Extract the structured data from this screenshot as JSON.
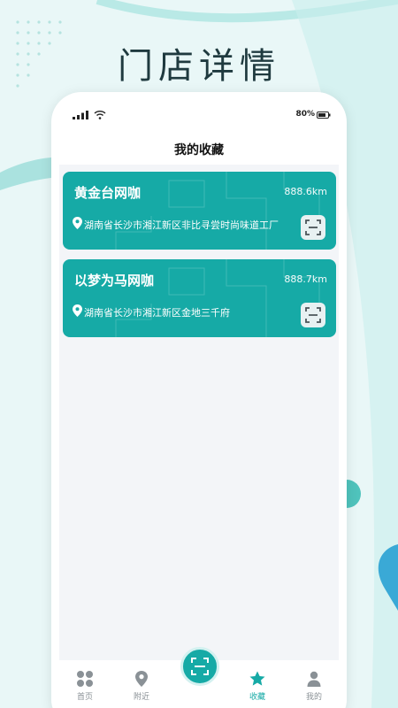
{
  "colors": {
    "accent": "#16aaa6",
    "background": "#e9f7f7",
    "text_dark": "#1f3a3f"
  },
  "headline": "门店详情",
  "status_bar": {
    "battery": "80%",
    "icons": [
      "signal-icon",
      "wifi-icon",
      "battery-icon"
    ]
  },
  "screen_title": "我的收藏",
  "favorites": [
    {
      "name": "黄金台网咖",
      "distance": "888.6km",
      "address": "湖南省长沙市湘江新区非比寻尝时尚味道工厂",
      "icons": [
        "location-pin-icon",
        "scan-icon"
      ]
    },
    {
      "name": "以梦为马网咖",
      "distance": "888.7km",
      "address": "湖南省长沙市湘江新区金地三千府",
      "icons": [
        "location-pin-icon",
        "scan-icon"
      ]
    }
  ],
  "tabbar": {
    "items": [
      {
        "label": "首页",
        "icon": "grid-icon"
      },
      {
        "label": "附近",
        "icon": "location-pin-icon"
      },
      {
        "label": "收藏",
        "icon": "star-icon",
        "active": true
      },
      {
        "label": "我的",
        "icon": "person-icon"
      }
    ],
    "center_icon": "scan-icon"
  }
}
